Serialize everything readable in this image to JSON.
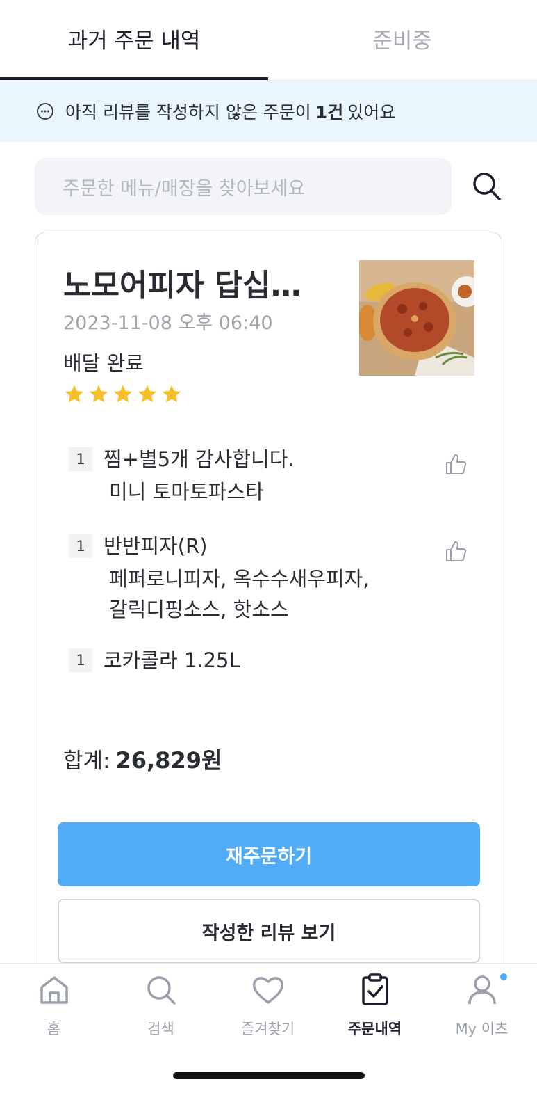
{
  "tabs": {
    "past_orders": "과거 주문 내역",
    "preparing": "준비중"
  },
  "notice": {
    "prefix": "아직 리뷰를 작성하지 않은 주문이",
    "count": "1건",
    "suffix": "있어요"
  },
  "search": {
    "placeholder": "주문한 메뉴/매장을 찾아보세요"
  },
  "order": {
    "store_name": "노모어피자 답십…",
    "date": "2023-11-08 오후 06:40",
    "status": "배달 완료",
    "rating": 5,
    "items": [
      {
        "qty": "1",
        "name": "찜+별5개 감사합니다.",
        "options": [
          "미니 토마토파스타"
        ]
      },
      {
        "qty": "1",
        "name": "반반피자(R)",
        "options": [
          "페퍼로니피자, 옥수수새우피자,",
          "갈릭디핑소스, 핫소스"
        ]
      },
      {
        "qty": "1",
        "name": "코카콜라 1.25L",
        "options": []
      }
    ],
    "total_label": "합계:",
    "total_value": "26,829원",
    "reorder_label": "재주문하기",
    "view_review_label": "작성한 리뷰 보기"
  },
  "nav": {
    "items": [
      {
        "label": "홈",
        "icon": "home-icon"
      },
      {
        "label": "검색",
        "icon": "search-icon"
      },
      {
        "label": "즐겨찾기",
        "icon": "heart-icon"
      },
      {
        "label": "주문내역",
        "icon": "order-history-icon"
      },
      {
        "label": "My 이츠",
        "icon": "user-icon"
      }
    ],
    "active": "주문내역"
  },
  "colors": {
    "accent": "#50acf6",
    "notice_bg": "#e9f6fd",
    "star": "#f7be2a"
  }
}
